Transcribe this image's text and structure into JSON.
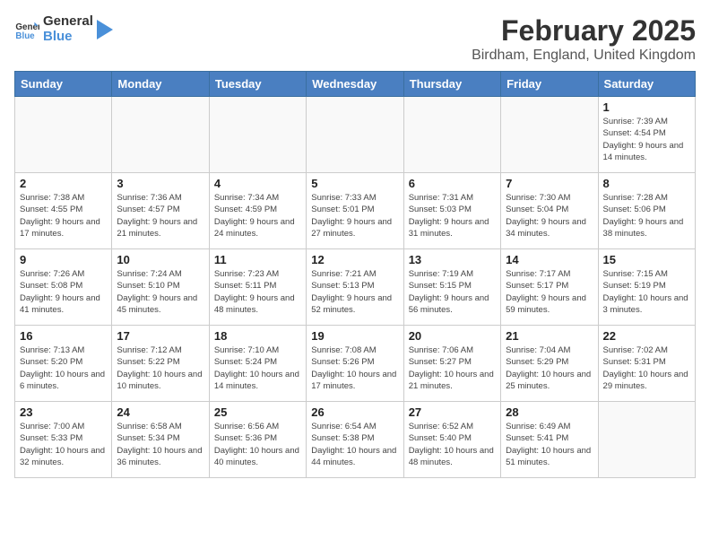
{
  "logo": {
    "text_general": "General",
    "text_blue": "Blue"
  },
  "header": {
    "title": "February 2025",
    "subtitle": "Birdham, England, United Kingdom"
  },
  "weekdays": [
    "Sunday",
    "Monday",
    "Tuesday",
    "Wednesday",
    "Thursday",
    "Friday",
    "Saturday"
  ],
  "weeks": [
    [
      {
        "day": "",
        "info": ""
      },
      {
        "day": "",
        "info": ""
      },
      {
        "day": "",
        "info": ""
      },
      {
        "day": "",
        "info": ""
      },
      {
        "day": "",
        "info": ""
      },
      {
        "day": "",
        "info": ""
      },
      {
        "day": "1",
        "info": "Sunrise: 7:39 AM\nSunset: 4:54 PM\nDaylight: 9 hours and 14 minutes."
      }
    ],
    [
      {
        "day": "2",
        "info": "Sunrise: 7:38 AM\nSunset: 4:55 PM\nDaylight: 9 hours and 17 minutes."
      },
      {
        "day": "3",
        "info": "Sunrise: 7:36 AM\nSunset: 4:57 PM\nDaylight: 9 hours and 21 minutes."
      },
      {
        "day": "4",
        "info": "Sunrise: 7:34 AM\nSunset: 4:59 PM\nDaylight: 9 hours and 24 minutes."
      },
      {
        "day": "5",
        "info": "Sunrise: 7:33 AM\nSunset: 5:01 PM\nDaylight: 9 hours and 27 minutes."
      },
      {
        "day": "6",
        "info": "Sunrise: 7:31 AM\nSunset: 5:03 PM\nDaylight: 9 hours and 31 minutes."
      },
      {
        "day": "7",
        "info": "Sunrise: 7:30 AM\nSunset: 5:04 PM\nDaylight: 9 hours and 34 minutes."
      },
      {
        "day": "8",
        "info": "Sunrise: 7:28 AM\nSunset: 5:06 PM\nDaylight: 9 hours and 38 minutes."
      }
    ],
    [
      {
        "day": "9",
        "info": "Sunrise: 7:26 AM\nSunset: 5:08 PM\nDaylight: 9 hours and 41 minutes."
      },
      {
        "day": "10",
        "info": "Sunrise: 7:24 AM\nSunset: 5:10 PM\nDaylight: 9 hours and 45 minutes."
      },
      {
        "day": "11",
        "info": "Sunrise: 7:23 AM\nSunset: 5:11 PM\nDaylight: 9 hours and 48 minutes."
      },
      {
        "day": "12",
        "info": "Sunrise: 7:21 AM\nSunset: 5:13 PM\nDaylight: 9 hours and 52 minutes."
      },
      {
        "day": "13",
        "info": "Sunrise: 7:19 AM\nSunset: 5:15 PM\nDaylight: 9 hours and 56 minutes."
      },
      {
        "day": "14",
        "info": "Sunrise: 7:17 AM\nSunset: 5:17 PM\nDaylight: 9 hours and 59 minutes."
      },
      {
        "day": "15",
        "info": "Sunrise: 7:15 AM\nSunset: 5:19 PM\nDaylight: 10 hours and 3 minutes."
      }
    ],
    [
      {
        "day": "16",
        "info": "Sunrise: 7:13 AM\nSunset: 5:20 PM\nDaylight: 10 hours and 6 minutes."
      },
      {
        "day": "17",
        "info": "Sunrise: 7:12 AM\nSunset: 5:22 PM\nDaylight: 10 hours and 10 minutes."
      },
      {
        "day": "18",
        "info": "Sunrise: 7:10 AM\nSunset: 5:24 PM\nDaylight: 10 hours and 14 minutes."
      },
      {
        "day": "19",
        "info": "Sunrise: 7:08 AM\nSunset: 5:26 PM\nDaylight: 10 hours and 17 minutes."
      },
      {
        "day": "20",
        "info": "Sunrise: 7:06 AM\nSunset: 5:27 PM\nDaylight: 10 hours and 21 minutes."
      },
      {
        "day": "21",
        "info": "Sunrise: 7:04 AM\nSunset: 5:29 PM\nDaylight: 10 hours and 25 minutes."
      },
      {
        "day": "22",
        "info": "Sunrise: 7:02 AM\nSunset: 5:31 PM\nDaylight: 10 hours and 29 minutes."
      }
    ],
    [
      {
        "day": "23",
        "info": "Sunrise: 7:00 AM\nSunset: 5:33 PM\nDaylight: 10 hours and 32 minutes."
      },
      {
        "day": "24",
        "info": "Sunrise: 6:58 AM\nSunset: 5:34 PM\nDaylight: 10 hours and 36 minutes."
      },
      {
        "day": "25",
        "info": "Sunrise: 6:56 AM\nSunset: 5:36 PM\nDaylight: 10 hours and 40 minutes."
      },
      {
        "day": "26",
        "info": "Sunrise: 6:54 AM\nSunset: 5:38 PM\nDaylight: 10 hours and 44 minutes."
      },
      {
        "day": "27",
        "info": "Sunrise: 6:52 AM\nSunset: 5:40 PM\nDaylight: 10 hours and 48 minutes."
      },
      {
        "day": "28",
        "info": "Sunrise: 6:49 AM\nSunset: 5:41 PM\nDaylight: 10 hours and 51 minutes."
      },
      {
        "day": "",
        "info": ""
      }
    ]
  ]
}
